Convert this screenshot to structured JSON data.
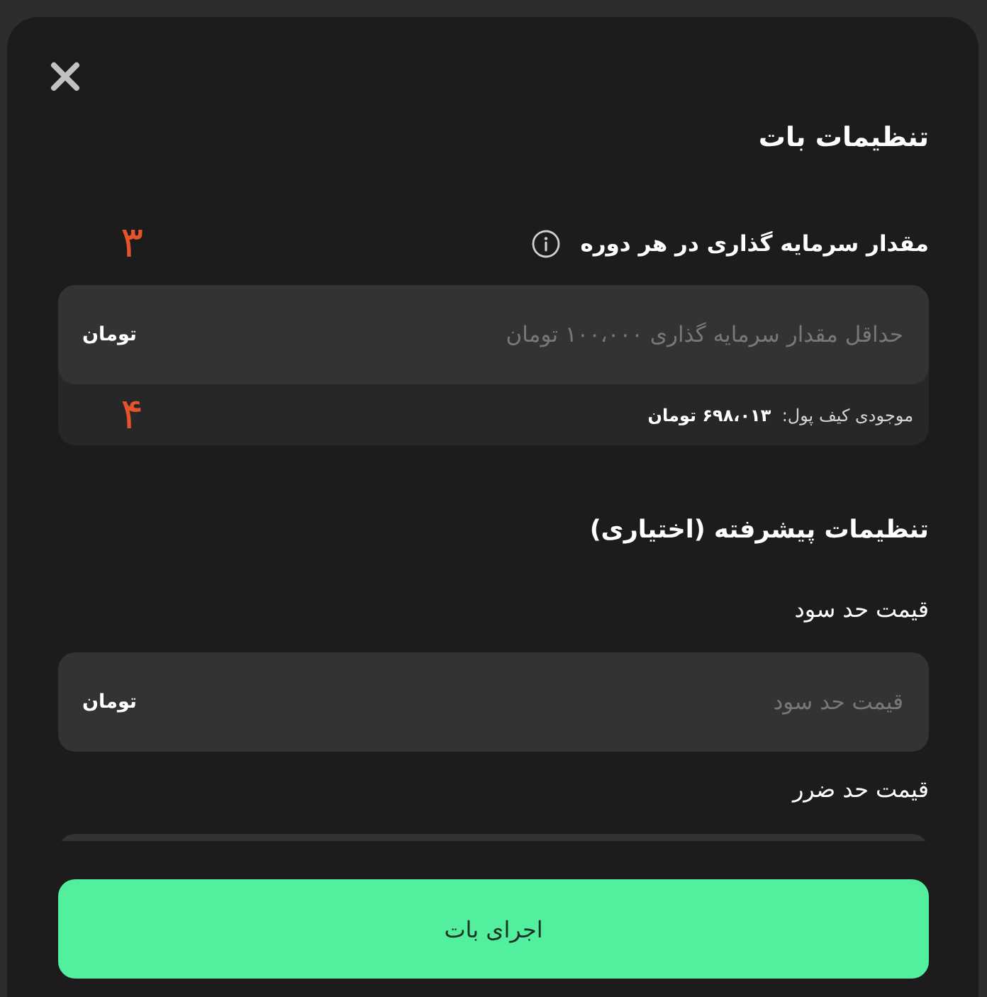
{
  "dialog": {
    "title": "تنظیمات بات"
  },
  "investment": {
    "label": "مقدار سرمایه گذاری در هر دوره",
    "label_callout": "۳",
    "placeholder": "حداقل مقدار سرمایه گذاری ۱۰۰،۰۰۰ تومان",
    "unit": "تومان",
    "balance": "موجودی کیف پول:  **۶۹۸،۰۱۳ تومان**",
    "balance_callout": "۴"
  },
  "advanced": {
    "title": "تنظیمات پیشرفته (اختیاری)",
    "fields": [
      {
        "label": "قیمت حد سود",
        "placeholder": "قیمت حد سود",
        "unit": "تومان"
      },
      {
        "label": "قیمت حد ضرر"
      }
    ]
  },
  "run_button": "اجرای بات"
}
